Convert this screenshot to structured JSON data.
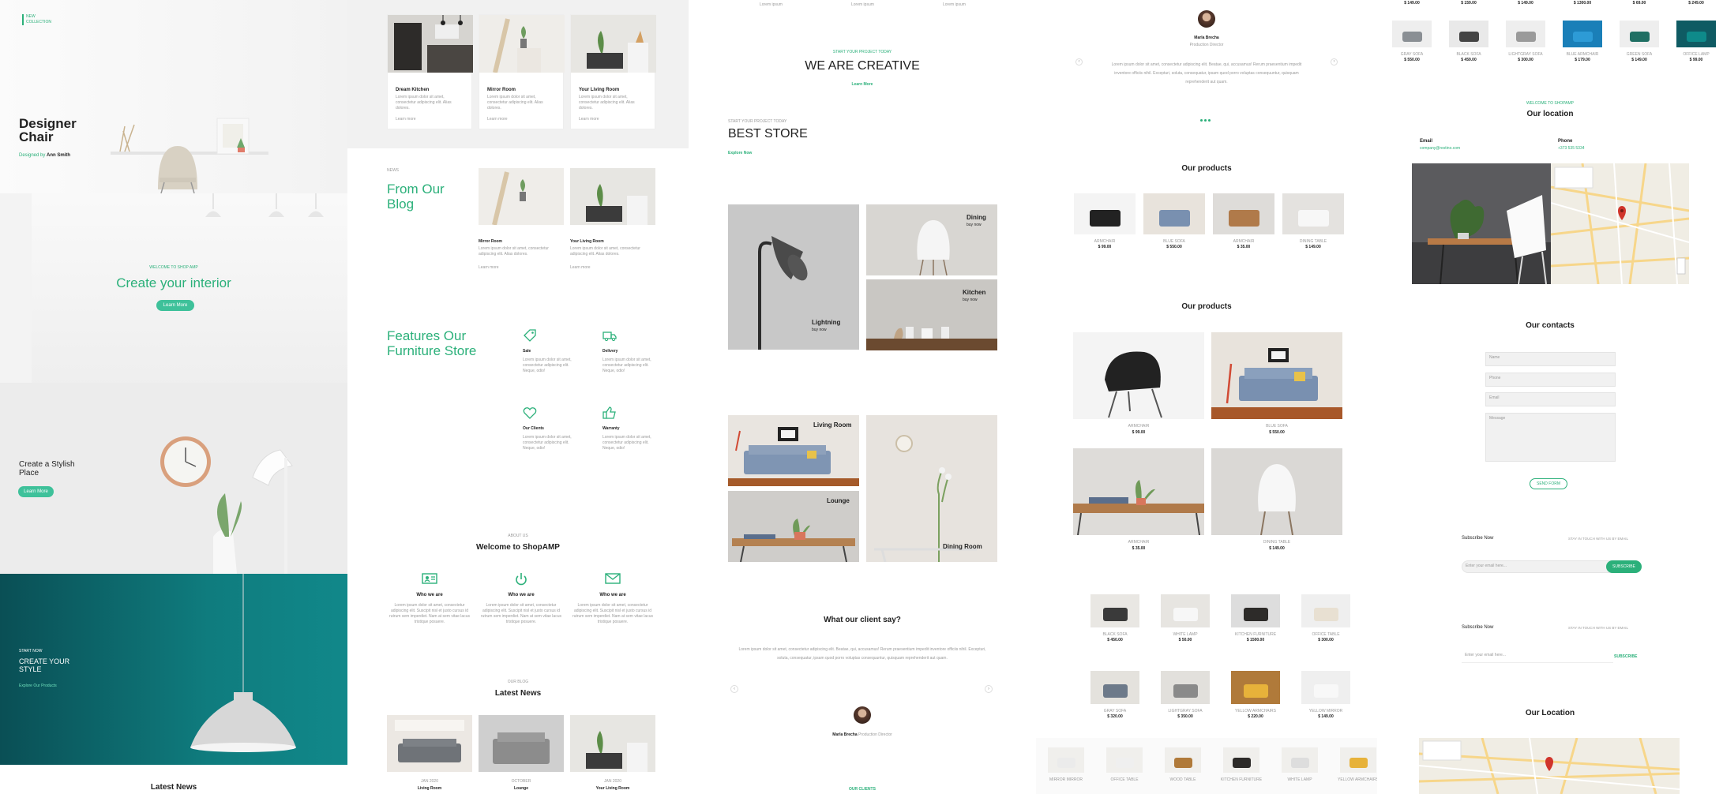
{
  "panel1": {
    "logo": [
      "NEW",
      "COLLECTION"
    ],
    "hero_title": "Designer Chair",
    "hero_sub_prefix": "Designed by",
    "hero_sub_name": "Ann Smith",
    "welcome_label": "WELCOME TO SHOP AMP",
    "welcome_title": "Create your interior",
    "welcome_button": "Learn More",
    "stylish_title": "Create a Stylish Place",
    "stylish_button": "Learn More",
    "style_kicker": "START NOW",
    "style_title": "CREATE YOUR STYLE",
    "style_link": "Explore Our Products",
    "footer_heading": "Latest News"
  },
  "panel2": {
    "top_cards": [
      {
        "label": "Dream Kitchen",
        "text": "Lorem ipsum dolor sit amet, consectetur adipiscing elit. Alias dolores.",
        "link": "Learn more"
      },
      {
        "label": "Mirror Room",
        "text": "Lorem ipsum dolor sit amet, consectetur adipiscing elit. Alias dolores.",
        "link": "Learn more"
      },
      {
        "label": "Your Living Room",
        "text": "Lorem ipsum dolor sit amet, consectetur adipiscing elit. Alias dolores.",
        "link": "Learn more"
      }
    ],
    "blog_kicker": "NEWS",
    "blog_title": "From Our Blog",
    "blog_cards": [
      {
        "label": "Mirror Room",
        "text": "Lorem ipsum dolor sit amet, consectetur adipiscing elit. Alias dolores.",
        "link": "Learn more"
      },
      {
        "label": "Your Living Room",
        "text": "Lorem ipsum dolor sit amet, consectetur adipiscing elit. Alias dolores.",
        "link": "Learn more"
      }
    ],
    "features_title": "Features Our Furniture Store",
    "features": [
      {
        "label": "Sale",
        "icon": "tag-icon",
        "text": "Lorem ipsum dolor sit amet, consectetur adipiscing elit. Neque, odio!"
      },
      {
        "label": "Delivery",
        "icon": "truck-icon",
        "text": "Lorem ipsum dolor sit amet, consectetur adipiscing elit. Neque, odio!"
      },
      {
        "label": "Our Clients",
        "icon": "heart-icon",
        "text": "Lorem ipsum dolor sit amet, consectetur adipiscing elit. Neque, odio!"
      },
      {
        "label": "Warranty",
        "icon": "thumbs-up-icon",
        "text": "Lorem ipsum dolor sit amet, consectetur adipiscing elit. Neque, odio!"
      }
    ],
    "welcome_kicker": "ABOUT US",
    "welcome_title": "Welcome to ShopAMP",
    "who": [
      {
        "label": "Who we are",
        "icon": "id-card-icon",
        "text": "Lorem ipsum dolor sit amet, consectetur adipiscing elit. Suscipit nisl et justo cursus id rutrum sem imperdiet. Nam at sem vitae lacus tristique posuere."
      },
      {
        "label": "Who we are",
        "icon": "power-icon",
        "text": "Lorem ipsum dolor sit amet, consectetur adipiscing elit. Suscipit nisl et justo cursus id rutrum sem imperdiet. Nam at sem vitae lacus tristique posuere."
      },
      {
        "label": "Who we are",
        "icon": "envelope-icon",
        "text": "Lorem ipsum dolor sit amet, consectetur adipiscing elit. Suscipit nisl et justo cursus id rutrum sem imperdiet. Nam at sem vitae lacus tristique posuere."
      }
    ],
    "news_kicker": "OUR BLOG",
    "news_title": "Latest News",
    "news_cards": [
      {
        "date": "JAN 2020",
        "label": "Living Room"
      },
      {
        "date": "OCTOBER",
        "label": "Lounge"
      },
      {
        "date": "JAN 2020",
        "label": "Your Living Room"
      }
    ]
  },
  "panel3": {
    "top_links": [
      "Lorem ipsum",
      "Lorem ipsum",
      "Lorem ipsum"
    ],
    "creative_kicker": "START YOUR PROJECT TODAY",
    "creative_title": "WE ARE CREATIVE",
    "creative_link": "Learn More",
    "store_kicker": "START YOUR PROJECT TODAY",
    "store_title": "BEST STORE",
    "store_link": "Explore Now",
    "tiles_top": [
      {
        "label": "Lightning",
        "sub": "buy now"
      },
      {
        "label": "Dining",
        "sub": "buy now"
      },
      {
        "label": "Kitchen",
        "sub": "buy now"
      }
    ],
    "tiles_bottom": [
      {
        "label": "Living Room"
      },
      {
        "label": "Lounge"
      },
      {
        "label": "Dining Room"
      }
    ],
    "client_title": "What our client say?",
    "client_text": "Lorem ipsum dolor sit amet, consectetur adipiscing elit. Beatae, qui, accusamus! Rerum praesentium impedit inventore officiis nihil. Excepturi, soluta, consequatur, ipsam quod porro voluptas consequuntur, quisquam reprehenderit aut quam.",
    "client_name": "Marla Brecha",
    "client_role": "Production Director",
    "footer_link": "OUR CLIENTS"
  },
  "panel4": {
    "person_name": "Marla Brecha",
    "person_role": "Production Director",
    "quote": "Lorem ipsum dolor sit amet, consectetur adipiscing elit. Beatae, qui, accusamus! Rerum praesentium impedit inventore officiis nihil. Excepturi, soluta, consequatur, ipsam quod porro voluptas consequuntur, quisquam reprehenderit aut quam.",
    "products_title_1": "Our products",
    "products_row1": [
      {
        "name": "ARMCHAIR",
        "price": "$ 99.00"
      },
      {
        "name": "BLUE SOFA",
        "price": "$ 550.00"
      },
      {
        "name": "ARMCHAIR",
        "price": "$ 35.00"
      },
      {
        "name": "DINING TABLE",
        "price": "$ 149.00"
      }
    ],
    "products_title_2": "Our products",
    "products_big": [
      {
        "name": "ARMCHAIR",
        "price": "$ 99.00"
      },
      {
        "name": "BLUE SOFA",
        "price": "$ 550.00"
      },
      {
        "name": "ARMCHAIR",
        "price": "$ 35.00"
      },
      {
        "name": "DINING TABLE",
        "price": "$ 149.00"
      }
    ],
    "products_grid": [
      {
        "name": "BLACK SOFA",
        "price": "$ 450.00"
      },
      {
        "name": "WHITE LAMP",
        "price": "$ 50.00"
      },
      {
        "name": "KITCHEN FURNITURE",
        "price": "$ 1500.00"
      },
      {
        "name": "OFFICE TABLE",
        "price": "$ 300.00"
      },
      {
        "name": "GRAY SOFA",
        "price": "$ 320.00"
      },
      {
        "name": "LIGHTGRAY SOFA",
        "price": "$ 350.00"
      },
      {
        "name": "YELLOW ARMCHAIRS",
        "price": "$ 220.00"
      },
      {
        "name": "YELLOW MIRROR",
        "price": "$ 149.00"
      }
    ],
    "products_strip": [
      "MIRROR MIRROR",
      "OFFICE TABLE",
      "WOOD TABLE",
      "KITCHEN FURNITURE",
      "WHITE LAMP",
      "YELLOW ARMCHAIRS"
    ]
  },
  "panel5": {
    "top_prices": [
      "$ 149.00",
      "$ 159.00",
      "$ 149.00",
      "$ 1300.00",
      "$ 69.00",
      "$ 249.00"
    ],
    "top_products": [
      {
        "name": "GRAY SOFA",
        "price": "$ 550.00"
      },
      {
        "name": "BLACK SOFA",
        "price": "$ 459.00"
      },
      {
        "name": "LIGHTGRAY SOFA",
        "price": "$ 300.00"
      },
      {
        "name": "BLUE ARMCHAIR",
        "price": "$ 179.00"
      },
      {
        "name": "GREEN SOFA",
        "price": "$ 149.00"
      },
      {
        "name": "OFFICE LAMP",
        "price": "$ 99.00"
      }
    ],
    "location_kicker": "WELCOME TO SHOPAMP",
    "location_title": "Our location",
    "email_label": "Email",
    "email_value": "company@restino.com",
    "phone_label": "Phone",
    "phone_value": "+373 535 5334",
    "contacts_title": "Our contacts",
    "fields": [
      "Name",
      "Phone",
      "Email",
      "Message"
    ],
    "send_button": "SEND FORM",
    "subscribe_1": {
      "title": "Subscribe Now",
      "note": "STAY IN TOUCH WITH US BY EMAIL",
      "placeholder": "Enter your email here...",
      "button": "SUBSCRIBE"
    },
    "subscribe_2": {
      "title": "Subscribe Now",
      "note": "STAY IN TOUCH WITH US BY EMAIL",
      "placeholder": "Enter your email here...",
      "button": "SUBSCRIBE"
    },
    "location_title_2": "Our Location"
  }
}
